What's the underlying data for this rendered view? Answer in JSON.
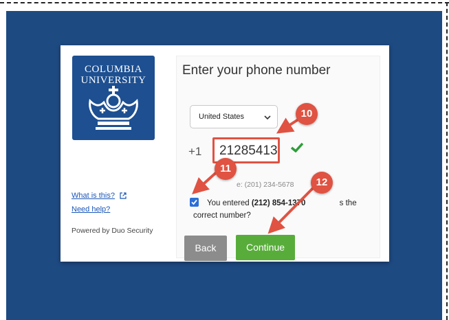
{
  "logo": {
    "line1": "COLUMBIA",
    "line2": "UNIVERSITY"
  },
  "sidebar": {
    "what_is_this": "What is this?",
    "need_help": "Need help?",
    "powered_by": "Powered by Duo Security"
  },
  "form": {
    "title": "Enter your phone number",
    "country_selected": "United States",
    "country_prefix": "+1",
    "phone_value": "21285413",
    "example_text": "e: (201) 234-5678",
    "confirm_prefix": "You entered ",
    "confirm_number": "(212) 854-1370",
    "confirm_middle": " ",
    "confirm_cut": "s the",
    "confirm_line2": "correct number?",
    "confirm_checked": true
  },
  "buttons": {
    "back": "Back",
    "continue": "Continue"
  },
  "annotations": {
    "step_phone": "10",
    "step_checkbox": "11",
    "step_continue": "12"
  },
  "colors": {
    "background": "#1e4a82",
    "annotation": "#e05242",
    "continue_button": "#58ad3a",
    "back_button": "#8c8c8c",
    "checkmark": "#2e9e3a",
    "logo_bg": "#1d4f91"
  },
  "icons": {
    "external_link": "external-link-icon",
    "dropdown": "chevron-down-icon",
    "valid": "checkmark-icon",
    "crown": "crown-icon"
  }
}
